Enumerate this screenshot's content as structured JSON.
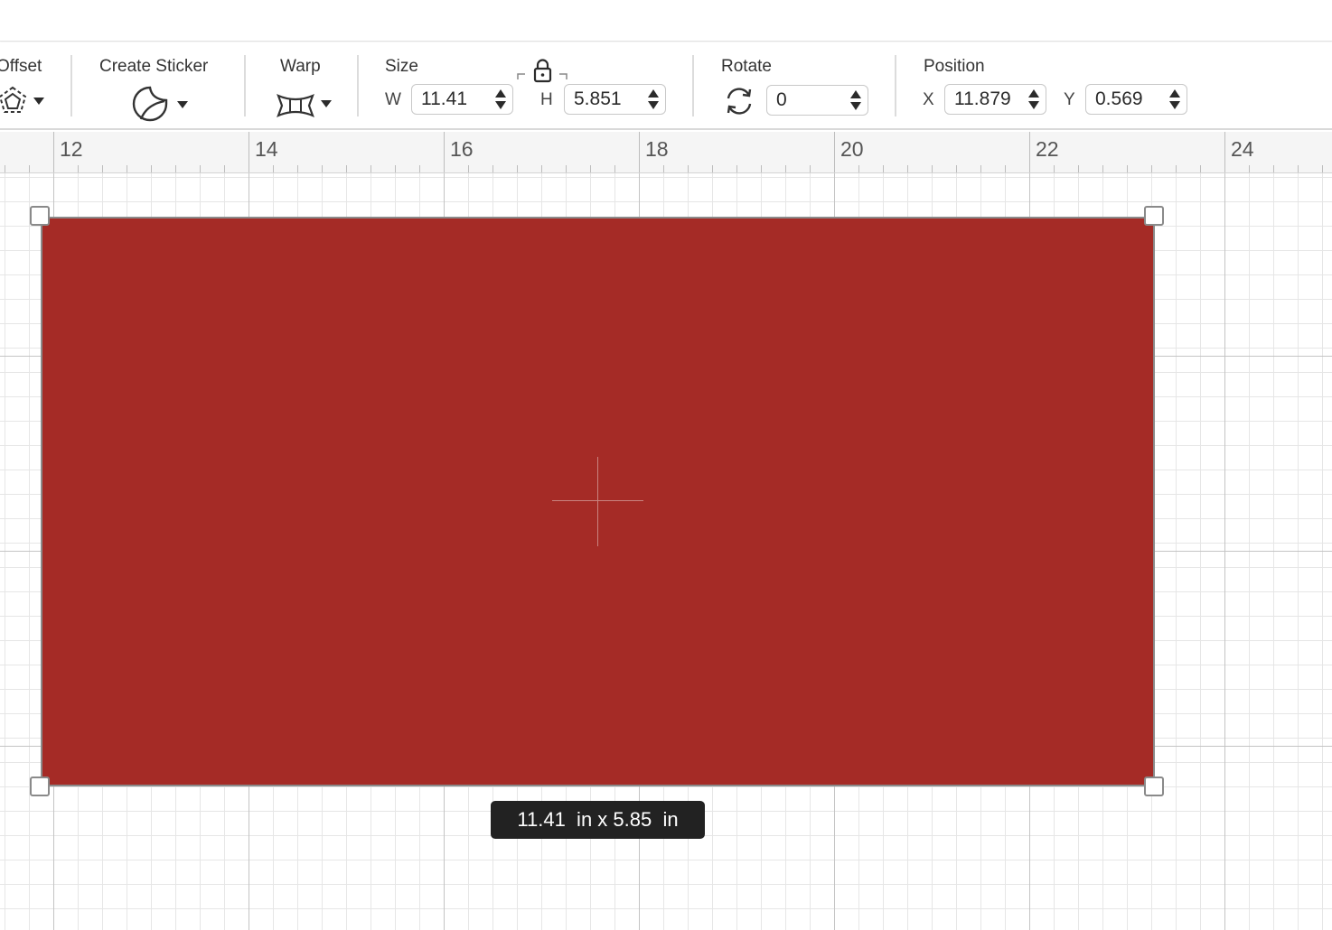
{
  "toolbar": {
    "offset": {
      "label": "Offset",
      "icon": "offset-icon"
    },
    "create_sticker": {
      "label": "Create Sticker",
      "icon": "sticker-icon"
    },
    "warp": {
      "label": "Warp",
      "icon": "warp-icon"
    },
    "size": {
      "label": "Size",
      "w_prefix": "W",
      "w_value": "11.41",
      "h_prefix": "H",
      "h_value": "5.851",
      "lock_icon": "lock-icon"
    },
    "rotate": {
      "label": "Rotate",
      "value": "0",
      "icon": "rotate-icon"
    },
    "position": {
      "label": "Position",
      "x_prefix": "X",
      "x_value": "11.879",
      "y_prefix": "Y",
      "y_value": "0.569"
    }
  },
  "ruler": {
    "labels": [
      "12",
      "14",
      "16",
      "18",
      "20",
      "22",
      "24"
    ]
  },
  "canvas": {
    "shape_color": "#a52b26",
    "size_tooltip": "11.41  in x 5.85  in"
  }
}
